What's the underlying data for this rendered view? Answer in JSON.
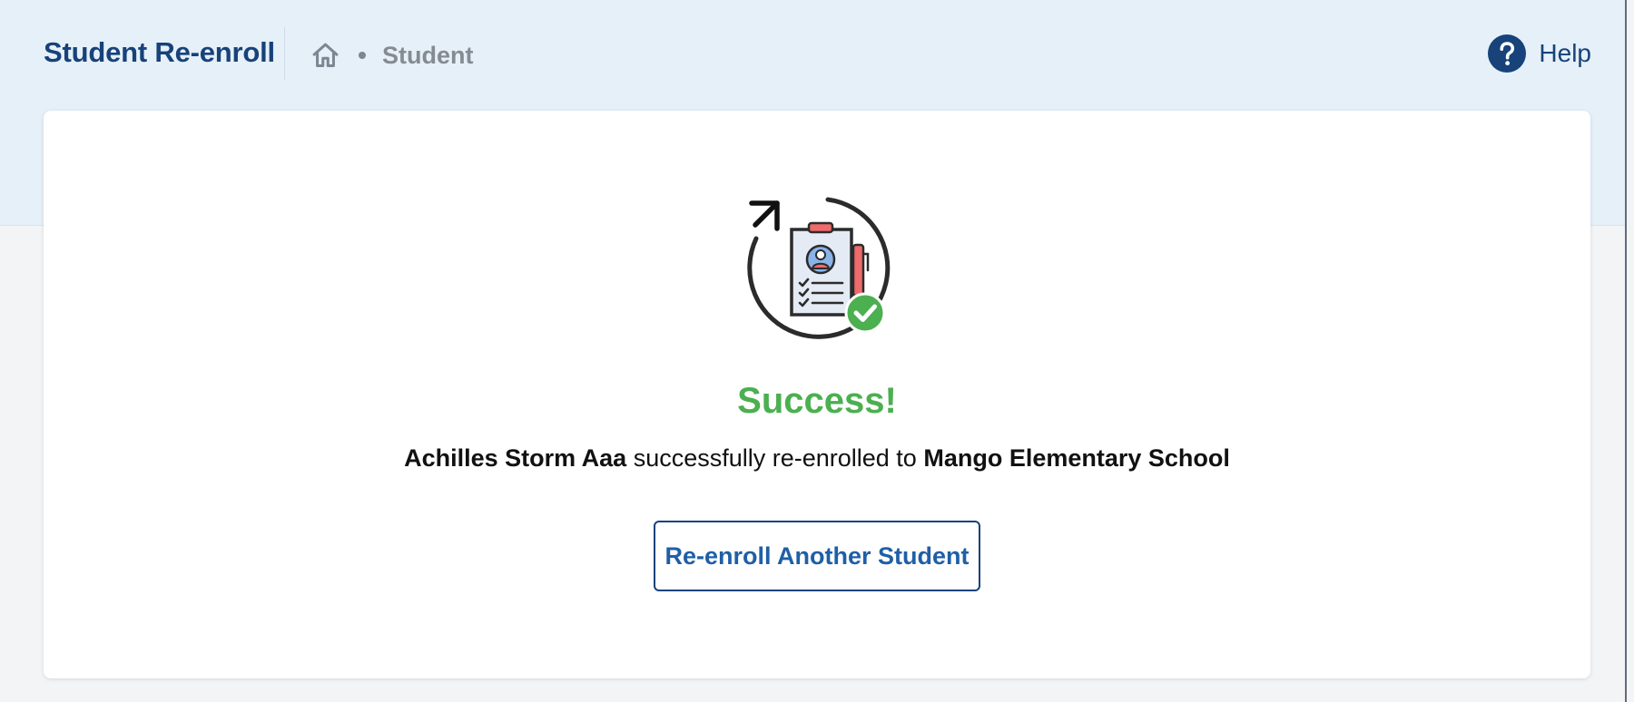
{
  "header": {
    "app_title": "Student Re-enroll",
    "breadcrumb": {
      "home_icon": "home-icon",
      "current": "Student"
    },
    "help": {
      "label": "Help",
      "icon": "question-circle-icon"
    }
  },
  "result": {
    "illustration_icon": "reenroll-success-illustration",
    "title": "Success!",
    "student_name": "Achilles Storm Aaa",
    "message_middle": " successfully re-enrolled to ",
    "school_name": "Mango Elementary School"
  },
  "actions": {
    "reenroll_another_label": "Re-enroll Another Student"
  },
  "colors": {
    "primary": "#17427a",
    "band": "#e6f0f8",
    "success": "#4caf50",
    "page_bg": "#f3f4f6"
  }
}
